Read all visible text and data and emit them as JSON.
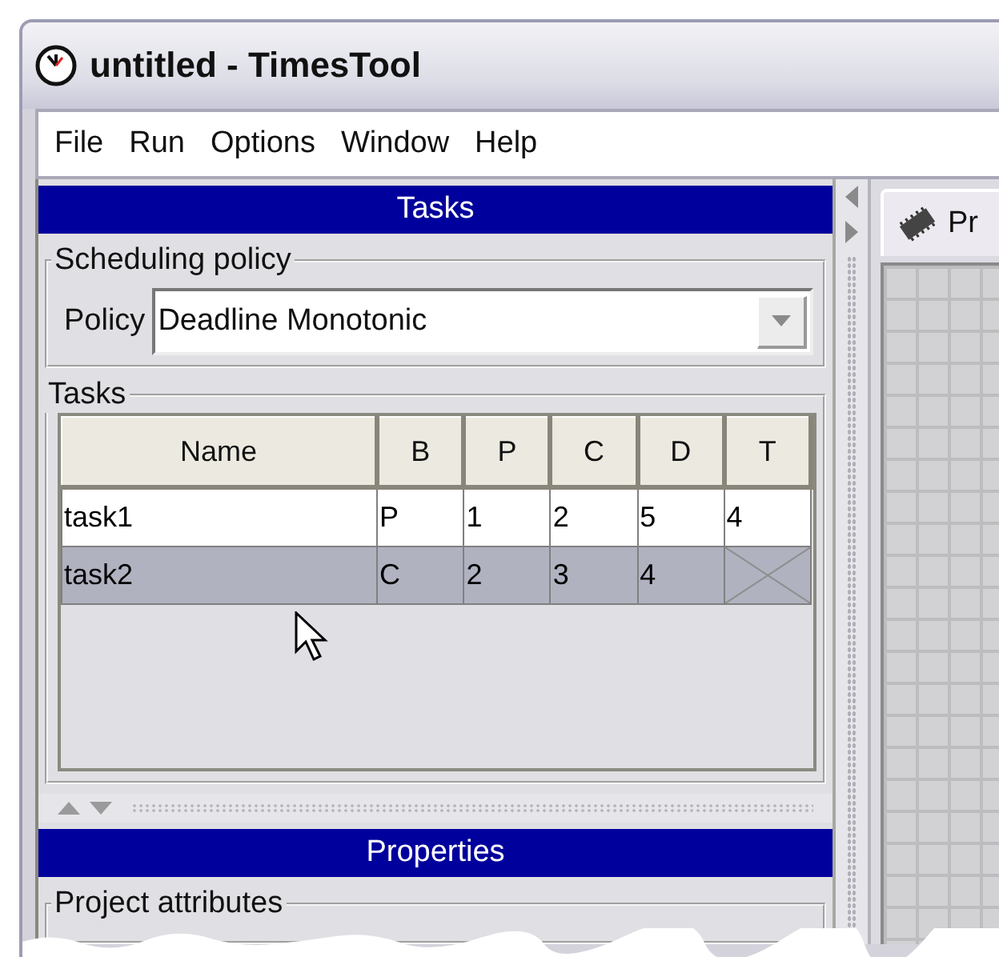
{
  "window": {
    "title": "untitled - TimesTool"
  },
  "menu": [
    "File",
    "Run",
    "Options",
    "Window",
    "Help"
  ],
  "tasks_panel": {
    "title": "Tasks",
    "scheduling": {
      "legend": "Scheduling policy",
      "label": "Policy",
      "value": "Deadline Monotonic"
    },
    "table": {
      "legend": "Tasks",
      "columns": [
        "Name",
        "B",
        "P",
        "C",
        "D",
        "T"
      ],
      "rows": [
        {
          "cells": [
            "task1",
            "P",
            "1",
            "2",
            "5",
            "4"
          ],
          "selected": false
        },
        {
          "cells": [
            "task2",
            "C",
            "2",
            "3",
            "4"
          ],
          "selected": true
        }
      ]
    }
  },
  "properties_panel": {
    "title": "Properties",
    "group": "Project attributes"
  },
  "editor": {
    "tab": "Pr"
  }
}
